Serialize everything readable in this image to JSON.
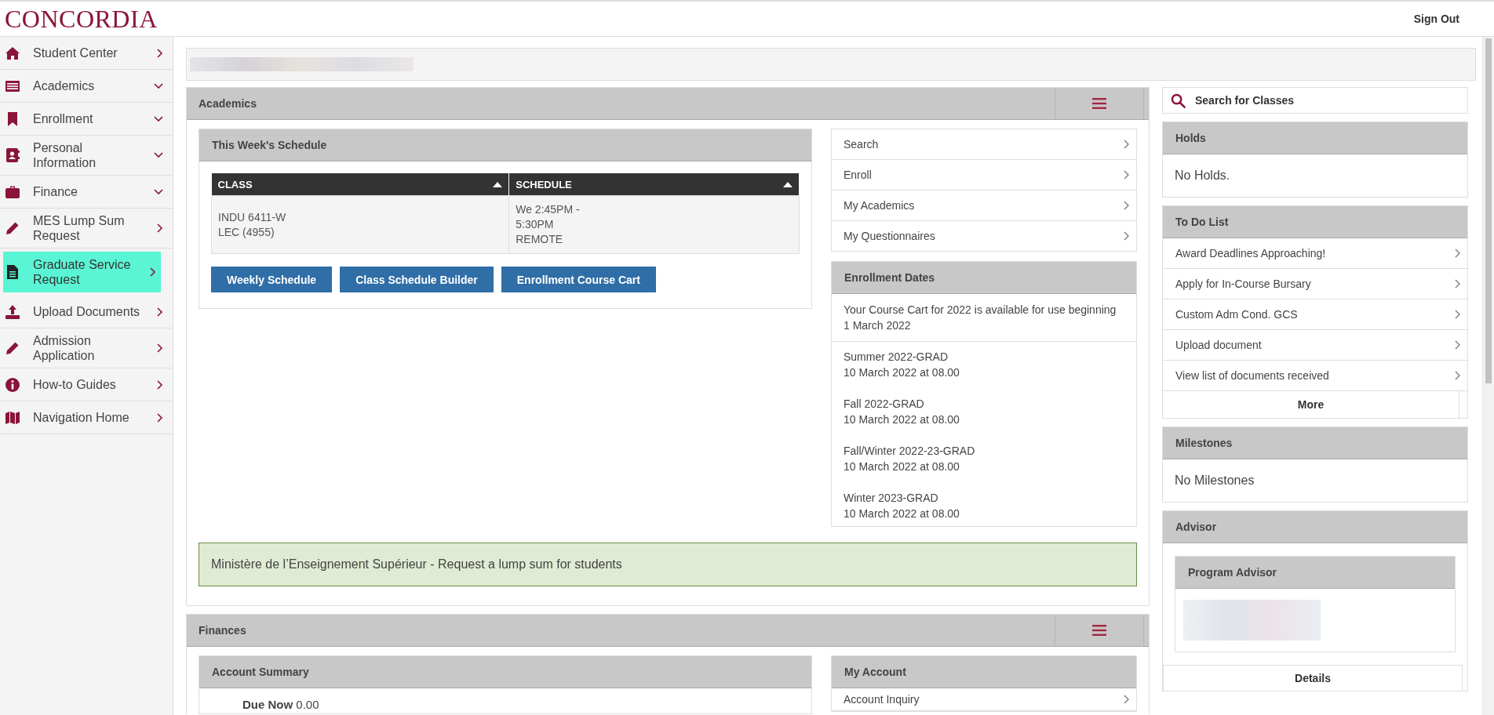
{
  "header": {
    "logo": "CONCORDIA",
    "sign_out": "Sign Out"
  },
  "sidebar": {
    "items": [
      {
        "label": "Student Center",
        "kind": "link",
        "selected": false
      },
      {
        "label": "Academics",
        "kind": "group",
        "selected": false
      },
      {
        "label": "Enrollment",
        "kind": "group",
        "selected": false
      },
      {
        "label": "Personal Information",
        "kind": "group",
        "selected": false
      },
      {
        "label": "Finance",
        "kind": "group",
        "selected": false
      },
      {
        "label": "MES Lump Sum Request",
        "kind": "link",
        "selected": false
      },
      {
        "label": "Graduate Service Request",
        "kind": "link",
        "selected": true
      },
      {
        "label": "Upload Documents",
        "kind": "link",
        "selected": false
      },
      {
        "label": "Admission Application",
        "kind": "link",
        "selected": false
      },
      {
        "label": "How-to Guides",
        "kind": "link",
        "selected": false
      },
      {
        "label": "Navigation Home",
        "kind": "link",
        "selected": false
      }
    ]
  },
  "academics": {
    "title": "Academics",
    "schedule": {
      "title": "This Week's Schedule",
      "columns": [
        "CLASS",
        "SCHEDULE"
      ],
      "rows": [
        [
          [
            "INDU 6411-W",
            "LEC (4955)"
          ],
          [
            "We 2:45PM -",
            "5:30PM",
            "REMOTE"
          ]
        ]
      ]
    },
    "buttons": [
      "Weekly Schedule",
      "Class Schedule Builder",
      "Enrollment Course Cart"
    ],
    "links": [
      "Search",
      "Enroll",
      "My Academics",
      "My Questionnaires"
    ],
    "enrollment_dates": {
      "title": "Enrollment Dates",
      "notice": "Your Course Cart for 2022 is available for use beginning 1 March 2022",
      "terms": [
        {
          "term": "Summer 2022-GRAD",
          "date": "10 March 2022 at 08.00"
        },
        {
          "term": "Fall 2022-GRAD",
          "date": "10 March 2022 at 08.00"
        },
        {
          "term": "Fall/Winter 2022-23-GRAD",
          "date": "10 March 2022 at 08.00"
        },
        {
          "term": "Winter 2023-GRAD",
          "date": "10 March 2022 at 08.00"
        }
      ]
    },
    "alert": "Ministère de l’Enseignement Supérieur - Request a lump sum for students"
  },
  "finances": {
    "title": "Finances",
    "account_summary": {
      "title": "Account Summary",
      "label": "Due Now",
      "amount": "0.00"
    },
    "my_account": {
      "title": "My Account",
      "links": [
        "Account Inquiry"
      ]
    }
  },
  "search_classes": "Search for Classes",
  "holds": {
    "title": "Holds",
    "message": "No Holds."
  },
  "todo": {
    "title": "To Do List",
    "items": [
      "Award Deadlines Approaching!",
      "Apply for In-Course Bursary",
      "Custom Adm Cond. GCS",
      "Upload document",
      "View list of documents received"
    ],
    "more": "More"
  },
  "milestones": {
    "title": "Milestones",
    "message": "No Milestones"
  },
  "advisor": {
    "title": "Advisor",
    "card_title": "Program Advisor",
    "details": "Details"
  }
}
